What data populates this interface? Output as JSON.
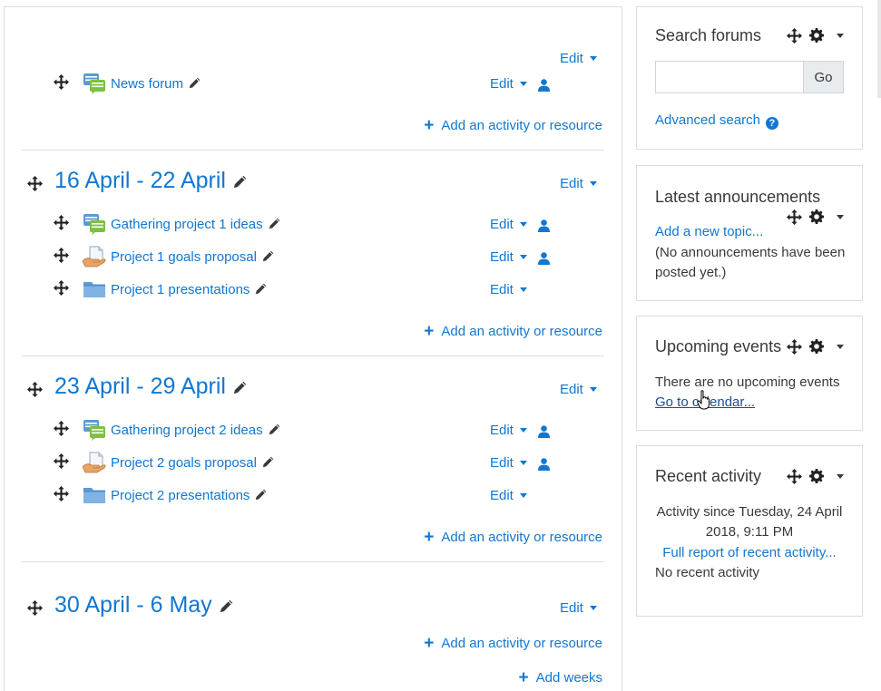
{
  "edit_label": "Edit",
  "add_activity_label": "Add an activity or resource",
  "add_weeks_label": "Add weeks",
  "section0": {
    "activities": [
      {
        "name": "News forum",
        "icon": "forum-icon"
      }
    ]
  },
  "sections": [
    {
      "title": "16 April - 22 April",
      "activities": [
        {
          "name": "Gathering project 1 ideas",
          "icon": "forum-icon"
        },
        {
          "name": "Project 1 goals proposal",
          "icon": "assignment-icon"
        },
        {
          "name": "Project 1 presentations",
          "icon": "folder-icon"
        }
      ]
    },
    {
      "title": "23 April - 29 April",
      "activities": [
        {
          "name": "Gathering project 2 ideas",
          "icon": "forum-icon"
        },
        {
          "name": "Project 2 goals proposal",
          "icon": "assignment-icon"
        },
        {
          "name": "Project 2 presentations",
          "icon": "folder-icon"
        }
      ]
    },
    {
      "title": "30 April - 6 May",
      "activities": []
    }
  ],
  "blocks": {
    "search_forums": {
      "title": "Search forums",
      "go_label": "Go",
      "search_value": "",
      "advanced_search": "Advanced search",
      "help_glyph": "?"
    },
    "latest_announcements": {
      "title": "Latest announcements",
      "add_topic": "Add a new topic...",
      "no_announcements_line1": "(No announcements have been",
      "no_announcements_line2": "posted yet.)"
    },
    "upcoming_events": {
      "title": "Upcoming events",
      "no_events": "There are no upcoming events",
      "calendar_link": "Go to calendar..."
    },
    "recent_activity": {
      "title": "Recent activity",
      "since_line1": "Activity since Tuesday, 24 April",
      "since_line2": "2018, 9:11 PM",
      "full_report": "Full report of recent activity...",
      "no_recent": "No recent activity"
    }
  },
  "colors": {
    "link": "#1177d1",
    "text": "#373a3c",
    "border": "#dcdcdc",
    "forum_green": "#7cc142",
    "folder_blue": "#5b9bd5"
  }
}
